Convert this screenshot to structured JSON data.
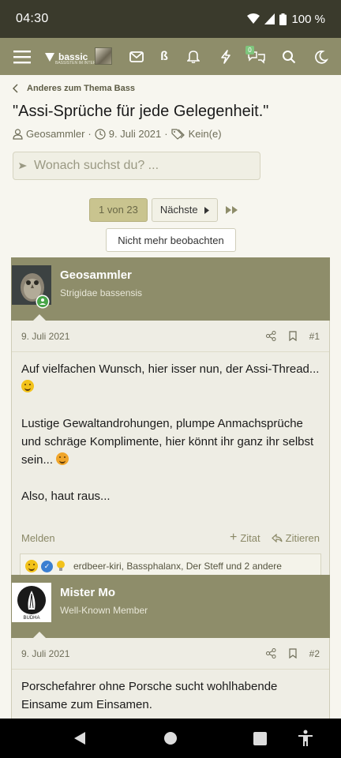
{
  "status_bar": {
    "time": "04:30",
    "battery": "100 %"
  },
  "app_bar": {
    "logo_name": "bassic",
    "logo_tagline": "BASSISTEN IM INTERNET",
    "conversations_badge": "0"
  },
  "breadcrumb": {
    "label": "Anderes zum Thema Bass"
  },
  "thread": {
    "title": "\"Assi-Sprüche für jede Gelegenheit.\"",
    "author": "Geosammler",
    "date": "9. Juli 2021",
    "tags": "Kein(e)"
  },
  "search": {
    "placeholder": "Wonach suchst du? ..."
  },
  "pagination": {
    "current": "1 von 23",
    "next_label": "Nächste"
  },
  "unwatch_label": "Nicht mehr beobachten",
  "posts": [
    {
      "username": "Geosammler",
      "user_title": "Strigidae bassensis",
      "date": "9. Juli 2021",
      "number": "#1",
      "paragraphs": [
        "Auf vielfachen Wunsch, hier isser nun, der Assi-Thread...",
        "Lustige Gewaltandrohungen, plumpe Anmachsprüche und schräge Komplimente, hier könnt ihr ganz ihr selbst sein...",
        "Also, haut raus..."
      ],
      "report_label": "Melden",
      "quote_plus_label": "Zitat",
      "reply_label": "Zitieren",
      "reactions": "erdbeer-kiri, Bassphalanx, Der Steff und 2 andere"
    },
    {
      "username": "Mister Mo",
      "user_title": "Well-Known Member",
      "avatar_text": "BUDHA",
      "date": "9. Juli 2021",
      "number": "#2",
      "paragraphs": [
        "Porschefahrer ohne Porsche sucht wohlhabende Einsame zum Einsamen."
      ]
    }
  ]
}
